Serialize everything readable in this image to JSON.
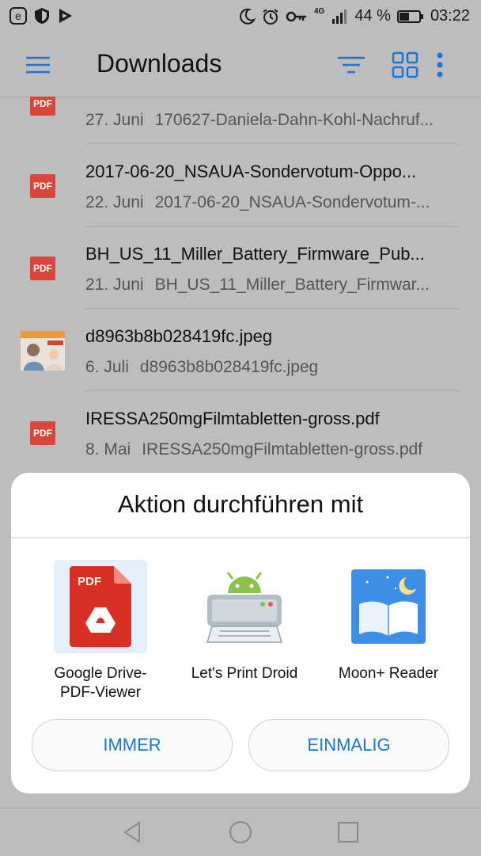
{
  "status_bar": {
    "battery_percent": "44 %",
    "time": "03:22",
    "network": "4G",
    "left_icons": [
      "e-icon",
      "shield-icon",
      "play-icon"
    ],
    "right_icons": [
      "moon-icon",
      "alarm-icon",
      "key-icon",
      "signal-icon",
      "battery-icon"
    ]
  },
  "app_bar": {
    "title": "Downloads",
    "icons": [
      "menu-icon",
      "sort-icon",
      "grid-view-icon",
      "more-icon"
    ],
    "accent": "#1976d2"
  },
  "files": [
    {
      "name": "",
      "date": "27. Juni",
      "detail": "170627-Daniela-Dahn-Kohl-Nachruf...",
      "thumb": "pdf-icon"
    },
    {
      "name": "2017-06-20_NSAUA-Sondervotum-Oppo...",
      "date": "22. Juni",
      "detail": "2017-06-20_NSAUA-Sondervotum-...",
      "thumb": "pdf-icon"
    },
    {
      "name": "BH_US_11_Miller_Battery_Firmware_Pub...",
      "date": "21. Juni",
      "detail": "BH_US_11_Miller_Battery_Firmwar...",
      "thumb": "pdf-icon"
    },
    {
      "name": "d8963b8b028419fc.jpeg",
      "date": "6. Juli",
      "detail": "d8963b8b028419fc.jpeg",
      "thumb": "image-thumbnail"
    },
    {
      "name": "IRESSA250mgFilmtabletten-gross.pdf",
      "date": "8. Mai",
      "detail": "IRESSA250mgFilmtabletten-gross.pdf",
      "thumb": "pdf-icon"
    }
  ],
  "pdf_badge_label": "PDF",
  "chooser": {
    "title": "Aktion durchführen mit",
    "apps": [
      {
        "label": "Google Drive-\nPDF-Viewer",
        "icon": "google-drive-pdf-icon",
        "selected": true
      },
      {
        "label": "Let's Print Droid",
        "icon": "print-droid-icon"
      },
      {
        "label": "Moon+ Reader",
        "icon": "moon-reader-icon"
      }
    ],
    "always_label": "IMMER",
    "once_label": "EINMALIG"
  },
  "nav_bar": {
    "icons": [
      "back-icon",
      "home-icon",
      "recents-icon"
    ]
  }
}
